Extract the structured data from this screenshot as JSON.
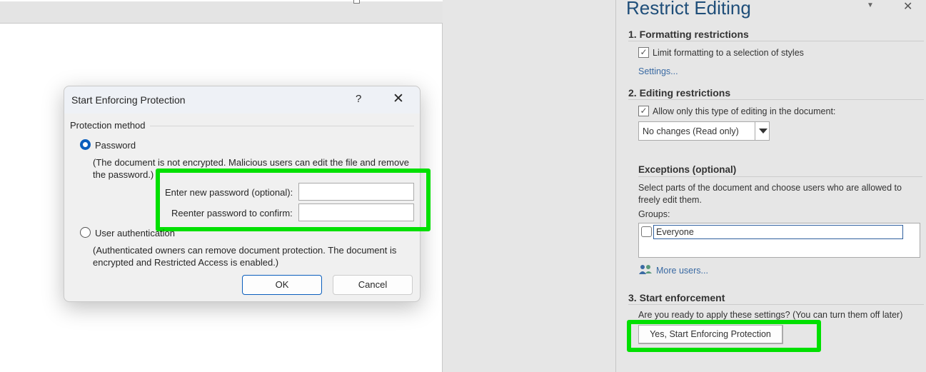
{
  "dialog": {
    "title": "Start Enforcing Protection",
    "help": "?",
    "close": "✕",
    "group_label": "Protection method",
    "password_option": "Password",
    "password_note": "(The document is not encrypted. Malicious users can edit the file and remove the password.)",
    "new_password_label": "Enter new password (optional):",
    "confirm_label": "Reenter password to confirm:",
    "new_password_value": "",
    "confirm_value": "",
    "user_auth_option": "User authentication",
    "user_auth_note": "(Authenticated owners can remove document protection. The document is encrypted and Restricted Access is enabled.)",
    "ok": "OK",
    "cancel": "Cancel",
    "selected_method": "Password"
  },
  "panel": {
    "title": "Restrict Editing",
    "dropdown_icon": "▼",
    "close": "✕",
    "section1": "1. Formatting restrictions",
    "limit_formatting": "Limit formatting to a selection of styles",
    "limit_formatting_checked": true,
    "settings_link": "Settings...",
    "section2": "2. Editing restrictions",
    "allow_only": "Allow only this type of editing in the document:",
    "allow_only_checked": true,
    "editing_type": "No changes (Read only)",
    "exceptions_title": "Exceptions (optional)",
    "exceptions_desc": "Select parts of the document and choose users who are allowed to freely edit them.",
    "groups_label": "Groups:",
    "group_everyone": "Everyone",
    "group_everyone_checked": false,
    "more_users": "More users...",
    "section3": "3. Start enforcement",
    "ready_text": "Are you ready to apply these settings? (You can turn them off later)",
    "start_button": "Yes, Start Enforcing Protection"
  },
  "colors": {
    "highlight": "#00e000",
    "accent": "#0a5ebd",
    "title_blue": "#1f4e79"
  }
}
